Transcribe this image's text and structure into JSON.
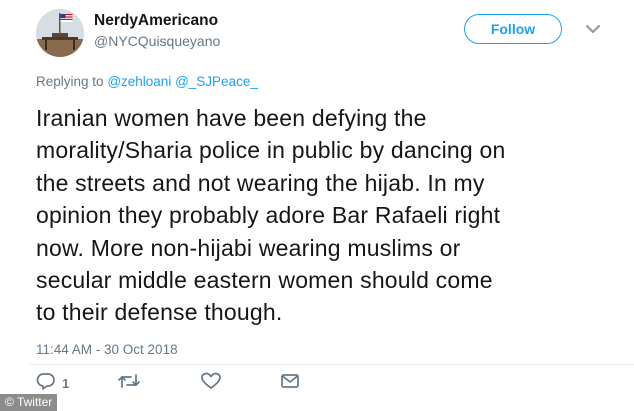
{
  "user": {
    "display_name": "NerdyAmericano",
    "handle": "@NYCQuisqueyano"
  },
  "follow_label": "Follow",
  "replying": {
    "prefix": "Replying to",
    "mentions": [
      "@zehloani",
      "@_SJPeace_"
    ]
  },
  "tweet_lines": [
    "Iranian women have been defying the",
    "morality/Sharia police in public by dancing on",
    "the streets and not wearing the hijab. In my",
    "opinion they probably adore Bar Rafaeli right",
    "now. More non-hijabi wearing muslims or",
    "secular middle eastern women should come",
    "to their defense though."
  ],
  "timestamp": "11:44 AM - 30 Oct 2018",
  "actions": {
    "reply_count": "1",
    "reply_icon": "reply-icon",
    "retweet_icon": "retweet-icon",
    "like_icon": "heart-icon",
    "dm_icon": "envelope-icon"
  },
  "credit": "© Twitter",
  "colors": {
    "accent": "#1da1f2",
    "text": "#14171a",
    "muted": "#657786"
  }
}
